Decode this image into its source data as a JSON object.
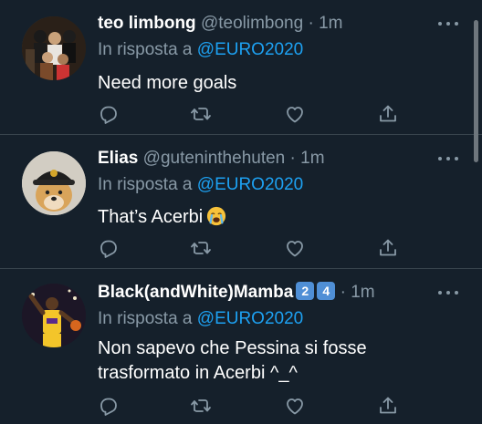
{
  "tweets": [
    {
      "display_name": "teo limbong",
      "handle": "@teolimbong",
      "separator": "·",
      "time": "1m",
      "reply_prefix": "In risposta a",
      "reply_to": "@EURO2020",
      "text": "Need more goals",
      "avatar_icon": "group-photo-avatar"
    },
    {
      "display_name": "Elias",
      "handle": "@guteninthehuten",
      "separator": "·",
      "time": "1m",
      "reply_prefix": "In risposta a",
      "reply_to": "@EURO2020",
      "text": "That’s Acerbi",
      "emoji": "crying-face-emoji",
      "avatar_icon": "dog-with-cap-avatar"
    },
    {
      "display_name": "Black(andWhite)Mamba",
      "badges": [
        "2",
        "4"
      ],
      "separator": "·",
      "time": "1m",
      "reply_prefix": "In risposta a",
      "reply_to": "@EURO2020",
      "text_line1": "Non sapevo che Pessina si fosse",
      "text_line2": "trasformato in Acerbi ^_^",
      "avatar_icon": "basketball-player-avatar"
    }
  ],
  "colors": {
    "background": "#15202b",
    "text_primary": "#ffffff",
    "text_secondary": "#8899a6",
    "link": "#1da1f2",
    "divider": "#38444d",
    "badge": "#4f8fd6"
  },
  "icons": [
    "reply-icon",
    "retweet-icon",
    "like-icon",
    "share-icon",
    "more-options-icon"
  ]
}
